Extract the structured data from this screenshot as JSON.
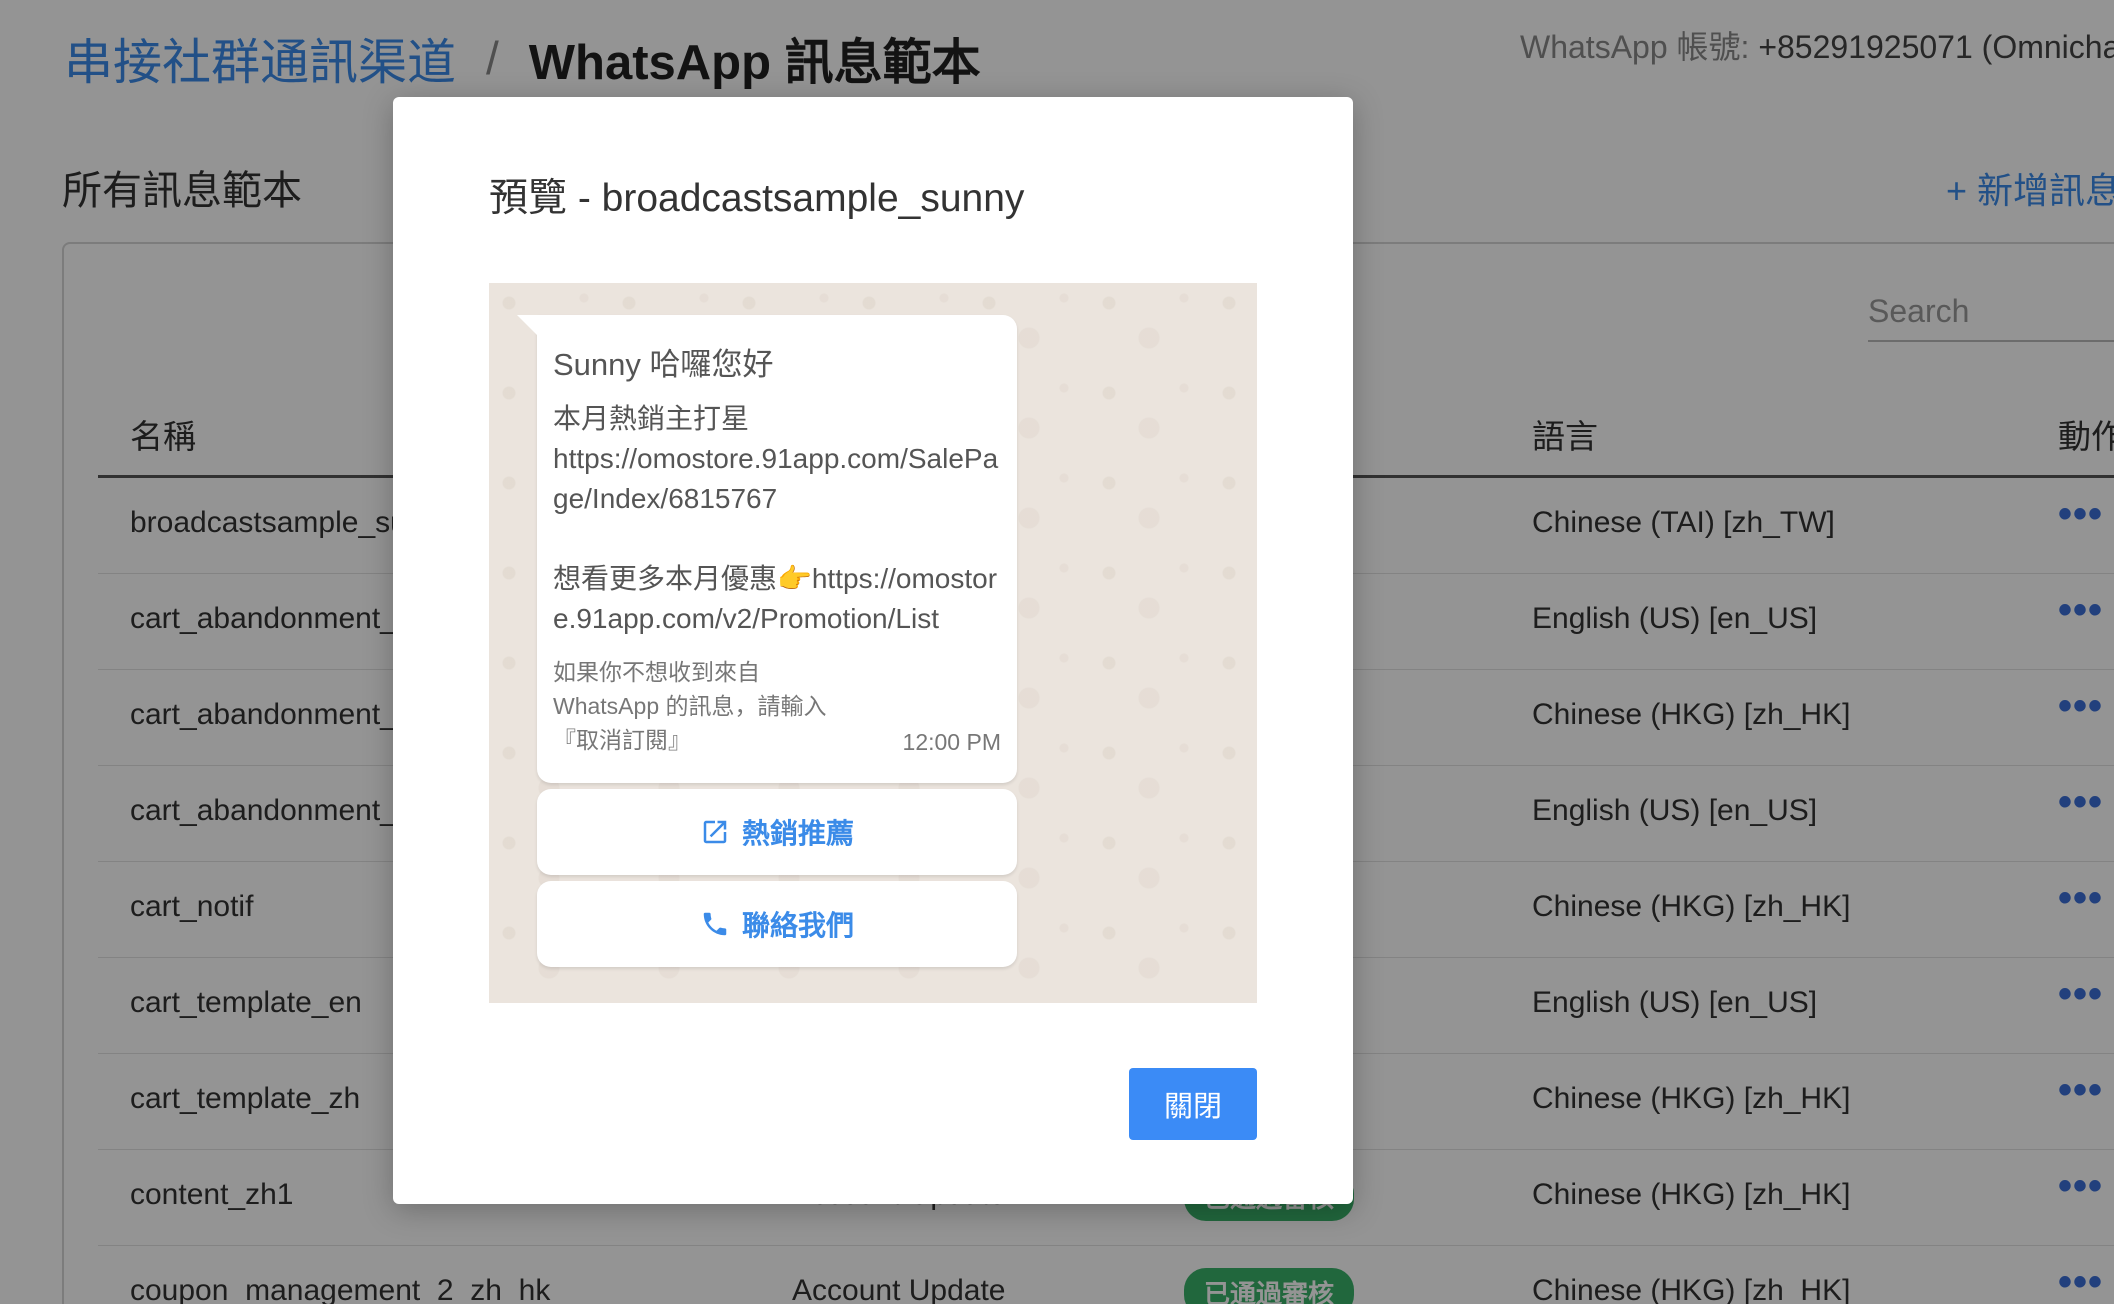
{
  "header": {
    "breadcrumb_link": "串接社群通訊渠道",
    "separator": "/",
    "current": "WhatsApp 訊息範本",
    "account_label": "WhatsApp 帳號: ",
    "account_value": "+85291925071 (Omnicha"
  },
  "section": {
    "title": "所有訊息範本",
    "add_label": "+ 新增訊息"
  },
  "search": {
    "placeholder": "Search"
  },
  "table": {
    "headers": {
      "name": "名稱",
      "language": "語言",
      "action": "動作"
    },
    "rows": [
      {
        "name": "broadcastsample_su",
        "category": "",
        "status": "",
        "language": "Chinese (TAI) [zh_TW]"
      },
      {
        "name": "cart_abandonment_re",
        "category": "",
        "status": "",
        "language": "English (US) [en_US]"
      },
      {
        "name": "cart_abandonment_re",
        "category": "",
        "status": "",
        "language": "Chinese (HKG) [zh_HK]"
      },
      {
        "name": "cart_abandonment_te",
        "category": "",
        "status": "",
        "language": "English (US) [en_US]"
      },
      {
        "name": "cart_notif",
        "category": "",
        "status": "",
        "language": "Chinese (HKG) [zh_HK]"
      },
      {
        "name": "cart_template_en",
        "category": "",
        "status": "",
        "language": "English (US) [en_US]"
      },
      {
        "name": "cart_template_zh",
        "category": "",
        "status": "",
        "language": "Chinese (HKG) [zh_HK]"
      },
      {
        "name": "content_zh1",
        "category": "Account Update",
        "status": "已通過審核",
        "language": "Chinese (HKG) [zh_HK]"
      },
      {
        "name": "coupon_management_2_zh_hk",
        "category": "Account Update",
        "status": "已通過審核",
        "language": "Chinese (HKG) [zh_HK]"
      }
    ],
    "more_symbol": "•••"
  },
  "modal": {
    "title": "預覽 - broadcastsample_sunny",
    "message": {
      "header": "Sunny 哈囉您好",
      "body": "本月熱銷主打星\nhttps://omostore.91app.com/SalePage/Index/6815767\n\n想看更多本月優惠👉https://omostore.91app.com/v2/Promotion/List",
      "footer": "如果你不想收到來自\nWhatsApp 的訊息，請輸入\n『取消訂閱』",
      "time": "12:00 PM"
    },
    "buttons": [
      {
        "label": "熱銷推薦",
        "icon": "external-link-icon"
      },
      {
        "label": "聯絡我們",
        "icon": "phone-icon"
      }
    ],
    "close_label": "關閉"
  },
  "colors": {
    "accent": "#3b8be8",
    "close_button": "#3b8bf6",
    "badge_green": "#3ab26a",
    "chat_background": "#ebe4dd"
  }
}
